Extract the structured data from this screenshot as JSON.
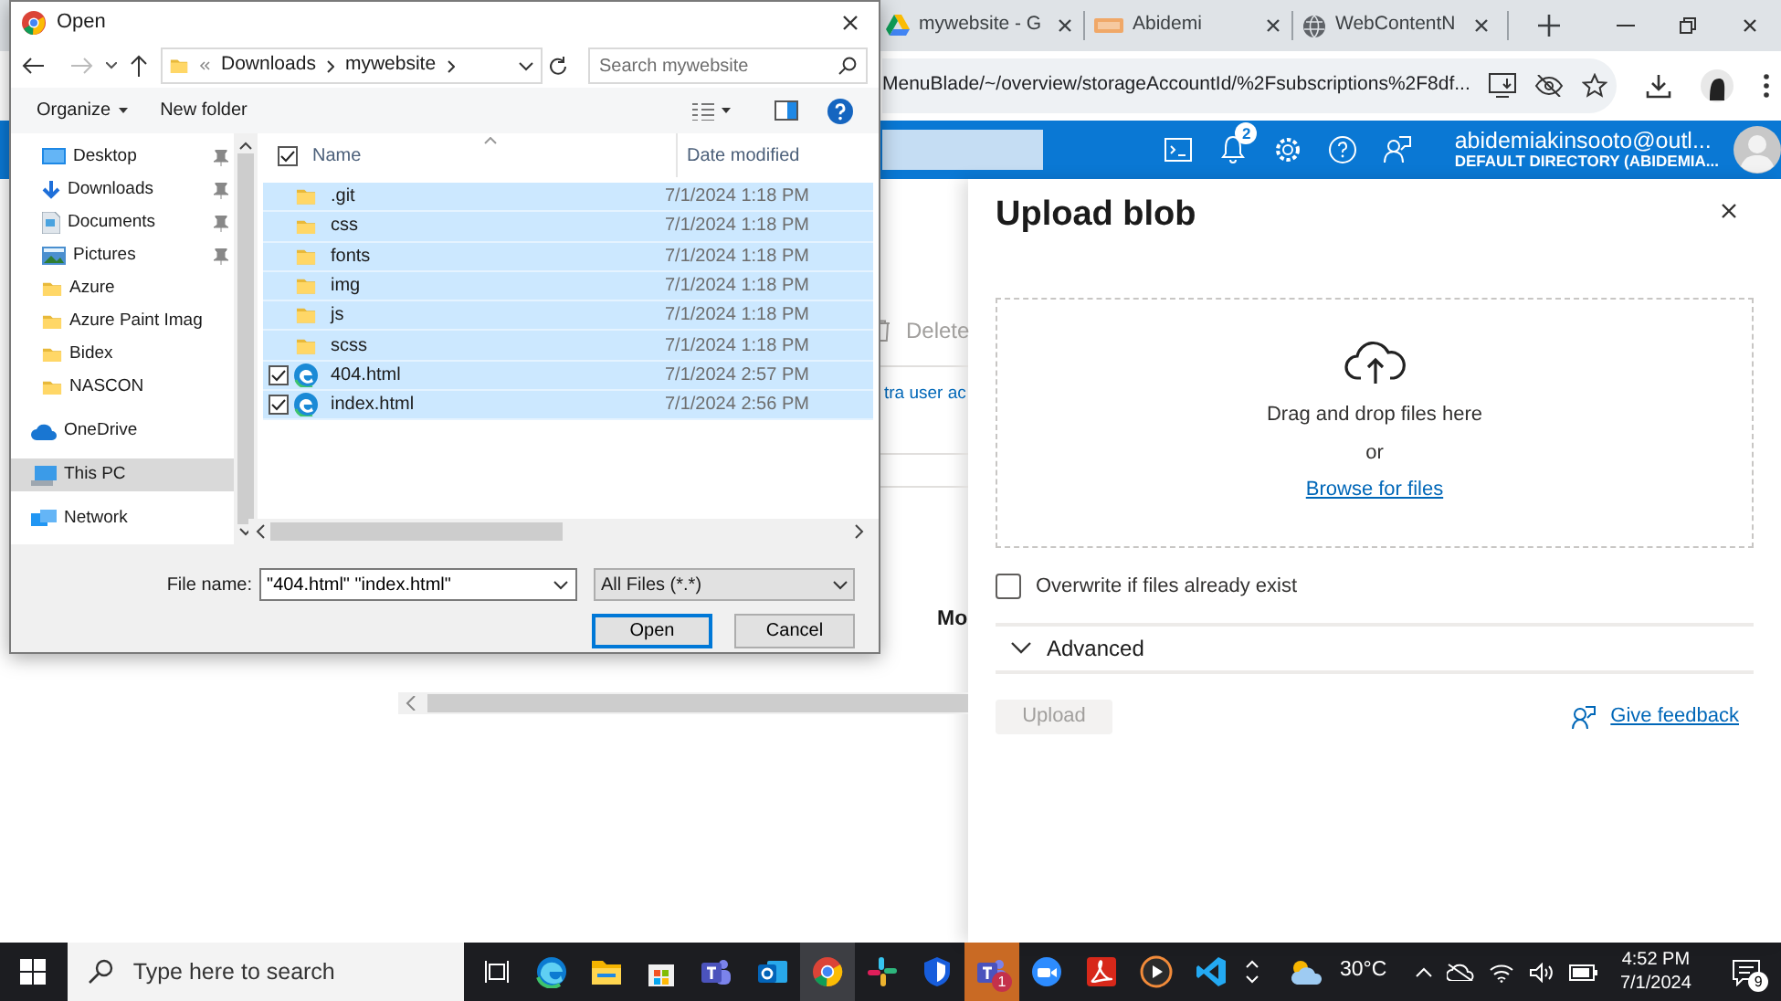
{
  "browser": {
    "tabs": [
      {
        "title": "mywebsite - G",
        "kind": "drive",
        "selected": false
      },
      {
        "title": "Abidemi",
        "kind": "logo",
        "selected": false
      },
      {
        "title": "WebContentN",
        "kind": "globe",
        "selected": false
      }
    ],
    "address": "MenuBlade/~/overview/storageAccountId/%2Fsubscriptions%2F8df..."
  },
  "portal": {
    "notifications": "2",
    "account_email": "abidemiakinsooto@outl...",
    "account_directory": "DEFAULT DIRECTORY (ABIDEMIA...",
    "toolbar_delete": "Delete",
    "link_text": "tra user ac",
    "column_text": "Mo"
  },
  "upload_panel": {
    "title": "Upload blob",
    "drop_text": "Drag and drop files here",
    "or_text": "or",
    "browse_link": "Browse for files",
    "overwrite": {
      "label": "Overwrite if files already exist",
      "checked": false
    },
    "advanced": {
      "label": "Advanced",
      "expanded": false
    },
    "upload_button": {
      "label": "Upload",
      "disabled": true
    },
    "feedback": "Give feedback"
  },
  "dialog": {
    "title": "Open",
    "path": [
      "Downloads",
      "mywebsite"
    ],
    "search_placeholder": "Search mywebsite",
    "organize": "Organize",
    "new_folder": "New folder",
    "nav": [
      {
        "label": "Desktop",
        "kind": "desktop",
        "pinned": true,
        "selected": false
      },
      {
        "label": "Downloads",
        "kind": "download",
        "pinned": true,
        "selected": false
      },
      {
        "label": "Documents",
        "kind": "document",
        "pinned": true,
        "selected": false
      },
      {
        "label": "Pictures",
        "kind": "pictures",
        "pinned": true,
        "selected": false
      },
      {
        "label": "Azure",
        "kind": "folder",
        "pinned": false,
        "selected": false
      },
      {
        "label": "Azure Paint Imag",
        "kind": "folder",
        "pinned": false,
        "selected": false
      },
      {
        "label": "Bidex",
        "kind": "folder",
        "pinned": false,
        "selected": false
      },
      {
        "label": "NASCON",
        "kind": "folder",
        "pinned": false,
        "selected": false
      },
      {
        "label": "OneDrive",
        "kind": "cloud",
        "pinned": false,
        "selected": false
      },
      {
        "label": "This PC",
        "kind": "pc",
        "pinned": false,
        "selected": true
      },
      {
        "label": "Network",
        "kind": "network",
        "pinned": false,
        "selected": false
      }
    ],
    "columns": [
      "Name",
      "Date modified"
    ],
    "select_all": true,
    "files": [
      {
        "name": ".git",
        "kind": "folder",
        "date": "7/1/2024 1:18 PM",
        "selected": true,
        "checked": false
      },
      {
        "name": "css",
        "kind": "folder",
        "date": "7/1/2024 1:18 PM",
        "selected": true,
        "checked": false
      },
      {
        "name": "fonts",
        "kind": "folder",
        "date": "7/1/2024 1:18 PM",
        "selected": true,
        "checked": false
      },
      {
        "name": "img",
        "kind": "folder",
        "date": "7/1/2024 1:18 PM",
        "selected": true,
        "checked": false
      },
      {
        "name": "js",
        "kind": "folder",
        "date": "7/1/2024 1:18 PM",
        "selected": true,
        "checked": false
      },
      {
        "name": "scss",
        "kind": "folder",
        "date": "7/1/2024 1:18 PM",
        "selected": true,
        "checked": false
      },
      {
        "name": "404.html",
        "kind": "html",
        "date": "7/1/2024 2:57 PM",
        "selected": true,
        "checked": true
      },
      {
        "name": "index.html",
        "kind": "html",
        "date": "7/1/2024 2:56 PM",
        "selected": true,
        "checked": true
      }
    ],
    "file_name_label": "File name:",
    "file_name": "\"404.html\" \"index.html\"",
    "filter": "All Files (*.*)",
    "buttons": [
      {
        "label": "Open",
        "default": true
      },
      {
        "label": "Cancel",
        "default": false
      }
    ]
  },
  "taskbar": {
    "search_placeholder": "Type here to search",
    "apps": [
      {
        "kind": "edge",
        "active": false,
        "flashing": false
      },
      {
        "kind": "explorer",
        "active": false,
        "flashing": false
      },
      {
        "kind": "store",
        "active": false,
        "flashing": false
      },
      {
        "kind": "teams",
        "active": false,
        "flashing": false
      },
      {
        "kind": "outlook",
        "active": false,
        "flashing": false
      },
      {
        "kind": "chrome",
        "active": true,
        "flashing": false
      },
      {
        "kind": "slack",
        "active": false,
        "flashing": false
      },
      {
        "kind": "shield",
        "active": false,
        "flashing": false
      },
      {
        "kind": "teams",
        "active": false,
        "flashing": true,
        "badge": "1"
      },
      {
        "kind": "zoom",
        "active": false,
        "flashing": false
      },
      {
        "kind": "acrobat",
        "active": false,
        "flashing": false
      },
      {
        "kind": "player",
        "active": false,
        "flashing": false
      },
      {
        "kind": "vscode",
        "active": false,
        "flashing": false
      }
    ],
    "weather": "30°C",
    "time": "4:52 PM",
    "date": "7/1/2024",
    "notifications": "9"
  }
}
